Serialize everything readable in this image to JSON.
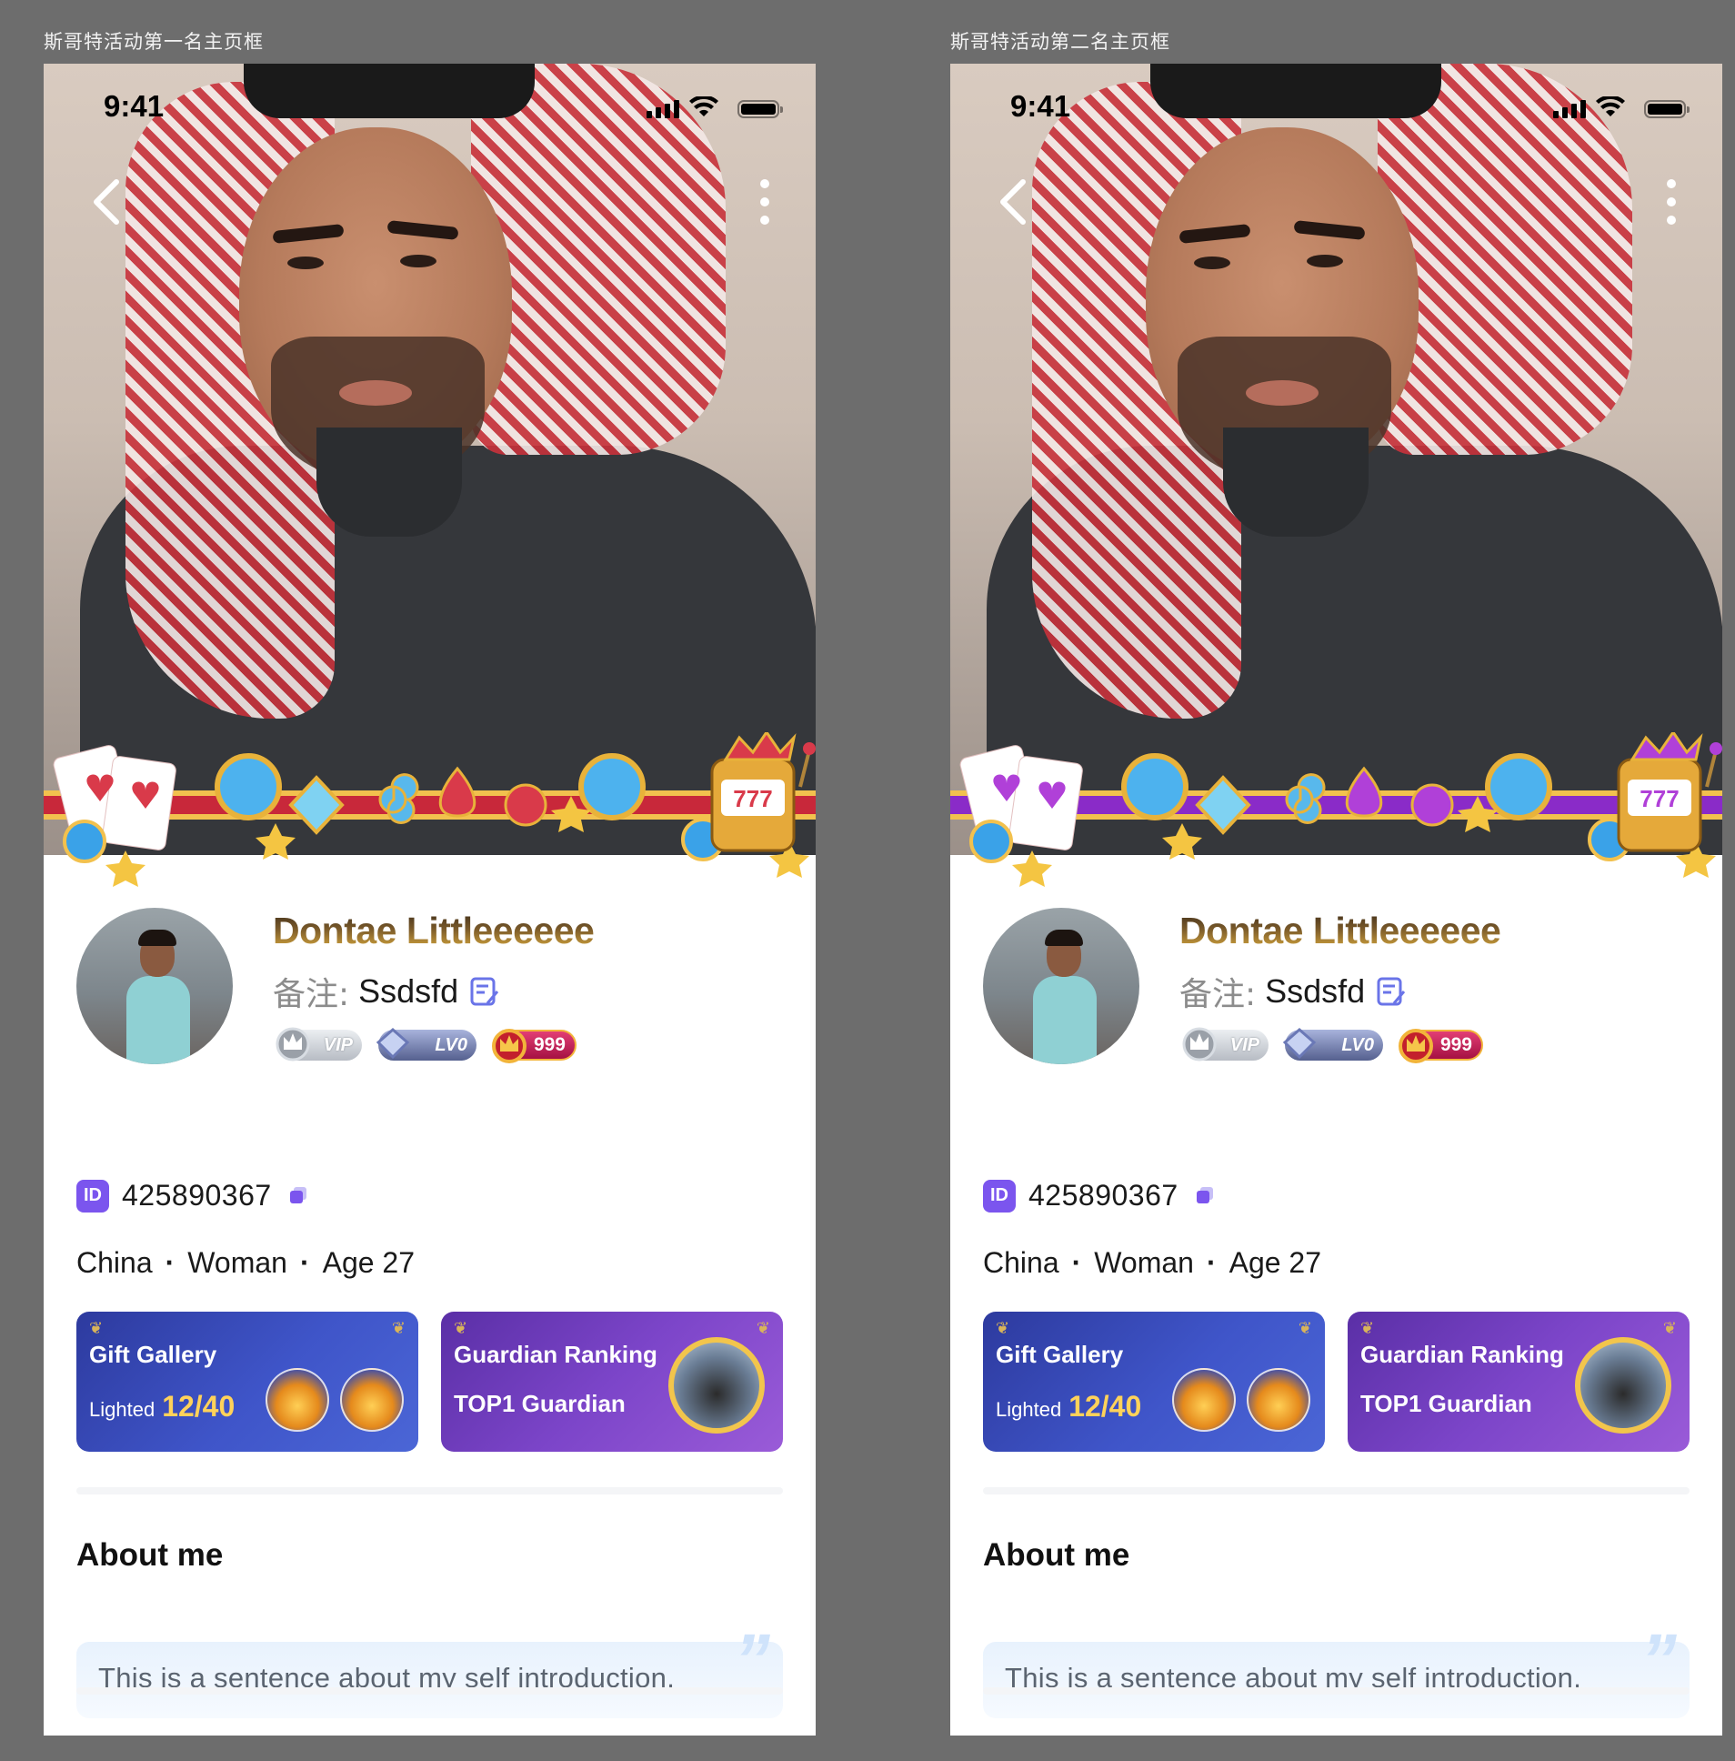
{
  "frames": [
    {
      "label": "斯哥特活动第一名主页框",
      "status_bar": {
        "time": "9:41"
      },
      "theme": {
        "accent": "#c8283a",
        "gem": "#d93a4a"
      },
      "profile": {
        "name": "Dontae Littleeeeee",
        "remark_label": "备注:",
        "remark_value": "Ssdsfd",
        "badges": {
          "vip": "VIP",
          "level": "LV0",
          "wealth": "999"
        },
        "id_tag": "ID",
        "id_value": "425890367",
        "country": "China",
        "gender": "Woman",
        "age": "Age 27",
        "separator": "·"
      },
      "cards": {
        "gift": {
          "title": "Gift Gallery",
          "sub_label": "Lighted",
          "sub_value": "12/40"
        },
        "guardian": {
          "title": "Guardian Ranking",
          "sub": "TOP1 Guardian"
        }
      },
      "about": {
        "title": "About me",
        "text": "This is a sentence about my self introduction.",
        "quote_mark": "”"
      }
    },
    {
      "label": "斯哥特活动第二名主页框",
      "status_bar": {
        "time": "9:41"
      },
      "theme": {
        "accent": "#8a2bc8",
        "gem": "#b040d8"
      },
      "profile": {
        "name": "Dontae Littleeeeee",
        "remark_label": "备注:",
        "remark_value": "Ssdsfd",
        "badges": {
          "vip": "VIP",
          "level": "LV0",
          "wealth": "999"
        },
        "id_tag": "ID",
        "id_value": "425890367",
        "country": "China",
        "gender": "Woman",
        "age": "Age 27",
        "separator": "·"
      },
      "cards": {
        "gift": {
          "title": "Gift Gallery",
          "sub_label": "Lighted",
          "sub_value": "12/40"
        },
        "guardian": {
          "title": "Guardian Ranking",
          "sub": "TOP1 Guardian"
        }
      },
      "about": {
        "title": "About me",
        "text": "This is a sentence about my self introduction.",
        "quote_mark": "”"
      }
    }
  ]
}
